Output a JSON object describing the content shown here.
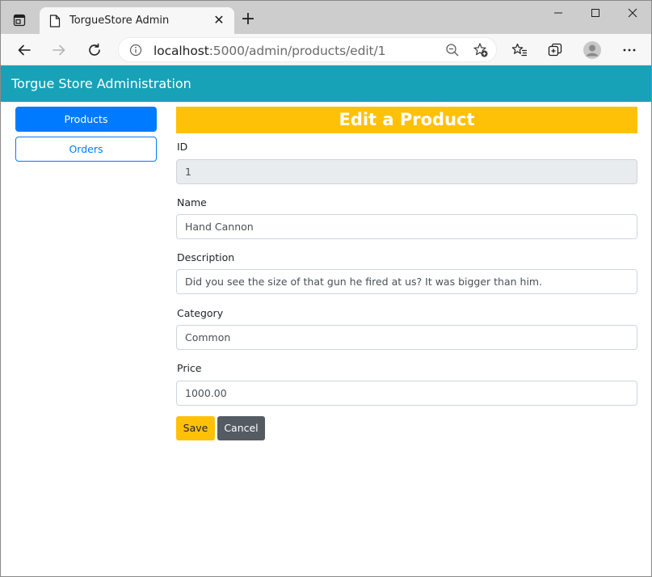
{
  "browser": {
    "tab_title": "TorgueStore Admin",
    "tab_close": "✕",
    "new_tab": "+",
    "address_host": "localhost",
    "address_path": ":5000/admin/products/edit/1"
  },
  "app": {
    "title": "Torgue Store Administration",
    "header_color": "#17a2b8"
  },
  "sidebar": {
    "items": [
      {
        "label": "Products",
        "active": true
      },
      {
        "label": "Orders",
        "active": false
      }
    ]
  },
  "form": {
    "heading": "Edit a Product",
    "fields": [
      {
        "label": "ID",
        "value": "1",
        "readonly": true
      },
      {
        "label": "Name",
        "value": "Hand Cannon",
        "readonly": false
      },
      {
        "label": "Description",
        "value": "Did you see the size of that gun he fired at us? It was bigger than him.",
        "readonly": false
      },
      {
        "label": "Category",
        "value": "Common",
        "readonly": false
      },
      {
        "label": "Price",
        "value": "1000.00",
        "readonly": false
      }
    ],
    "save_label": "Save",
    "cancel_label": "Cancel"
  },
  "colors": {
    "primary": "#007bff",
    "warning": "#ffc107",
    "secondary": "#545b62"
  }
}
